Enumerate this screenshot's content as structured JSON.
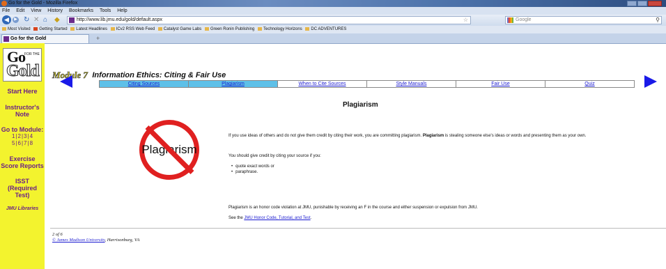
{
  "window": {
    "title": "Go for the Gold - Mozilla Firefox"
  },
  "menu": [
    "File",
    "Edit",
    "View",
    "History",
    "Bookmarks",
    "Tools",
    "Help"
  ],
  "navbar": {
    "url": "http://www.lib.jmu.edu/gold/default.aspx",
    "search_placeholder": "Google"
  },
  "bookmarks": [
    "Most Visited",
    "Getting Started",
    "Latest Headlines",
    "ICv2 RSS Web Feed",
    "Catalyst Game Labs",
    "Green Ronin Publishing",
    "Technology Horizons",
    "DC ADVENTURES"
  ],
  "tab": {
    "title": "Go for the Gold",
    "new_tab": "+"
  },
  "logo": {
    "go": "Go",
    "gold": "Gold",
    "for_the": "FOR THE"
  },
  "sidebar": {
    "start_here": "Start Here",
    "instructors_note": "Instructor's Note",
    "goto_module": "Go to Module:",
    "module_links": [
      "1",
      "2",
      "3",
      "4",
      "5",
      "6",
      "7",
      "8"
    ],
    "exercise_scores": "Exercise Score Reports",
    "isst": "ISST (Required Test)",
    "jmu_libraries": "JMU Libraries"
  },
  "module": {
    "tag": "Module 7",
    "title": "Information Ethics: Citing & Fair Use"
  },
  "subnav": [
    "Citing Sources",
    "Plagiarism",
    "When to Cite Sources",
    "Style Manuals",
    "Fair Use",
    "Quiz"
  ],
  "page": {
    "heading": "Plagiarism",
    "sign_text": "Plagiarism",
    "p1_a": "If you use ideas of others and do not give them credit by citing their work, you are committing plagiarism.",
    "p1_kw": "Plagiarism",
    "p1_b": "is stealing someone else's ideas or words and presenting them as your own.",
    "p2": "You should give credit by citing your source if you:",
    "list": [
      "quote exact words or",
      "paraphrase."
    ],
    "p3": "Plagiarism is an honor code violation at JMU, punishable by receiving an F in the course and either suspension or expulsion from JMU.",
    "p4_prefix": "See the",
    "p4_link": "JMU Honor Code, Tutorial, and Test",
    "p4_suffix": "."
  },
  "footer": {
    "page_count": "2 of 6",
    "copyright_link": "© James Madison University",
    "location": ", Harrisonburg, VA"
  },
  "colors": {
    "sidebar": "#f3f32e",
    "accent_blue": "#1a1ae8",
    "active_tab": "#5ec0e8",
    "no_sign_red": "#e02020"
  }
}
